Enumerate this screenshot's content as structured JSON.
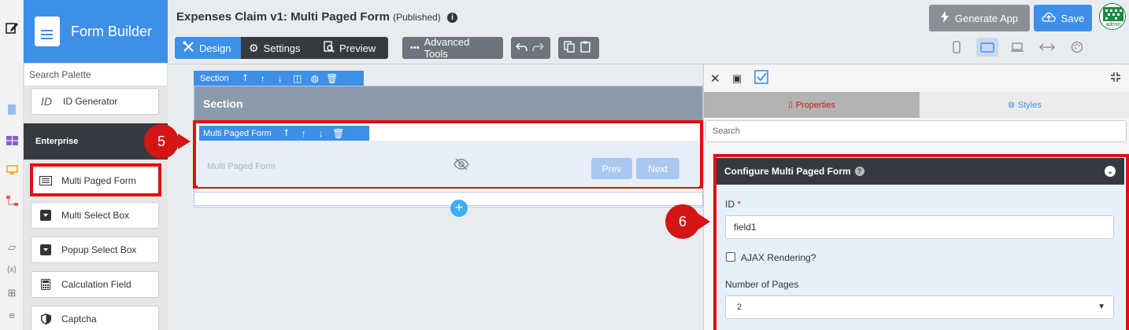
{
  "palette": {
    "brand_title": "Form Builder",
    "search_placeholder": "Search Palette",
    "id_generator": "ID Generator",
    "enterprise": "Enterprise",
    "items": [
      "Multi Paged Form",
      "Multi Select Box",
      "Popup Select Box",
      "Calculation Field",
      "Captcha"
    ]
  },
  "header": {
    "title": "Expenses Claim v1: Multi Paged Form",
    "status": "(Published)",
    "generate_app": "Generate App",
    "save": "Save",
    "design": "Design",
    "settings": "Settings",
    "preview": "Preview",
    "advanced_tools": "Advanced Tools",
    "avatar_label": "admin"
  },
  "canvas": {
    "section_bar_label": "Section",
    "section_title": "Section",
    "mpf_bar_label": "Multi Paged Form",
    "mpf_label": "Multi Paged Form",
    "prev": "Prev",
    "next": "Next"
  },
  "callouts": {
    "five": "5",
    "six": "6"
  },
  "panel": {
    "tab_properties": "Properties",
    "tab_styles": "Styles",
    "search_placeholder": "Search",
    "config_title": "Configure Multi Paged Form",
    "id_label": "ID",
    "required_mark": "*",
    "id_value": "field1",
    "ajax_label": "AJAX Rendering?",
    "pages_label": "Number of Pages",
    "pages_value": "2"
  },
  "colors": {
    "accent": "#3d8fe8",
    "highlight": "#e01010",
    "dark": "#343a40"
  }
}
